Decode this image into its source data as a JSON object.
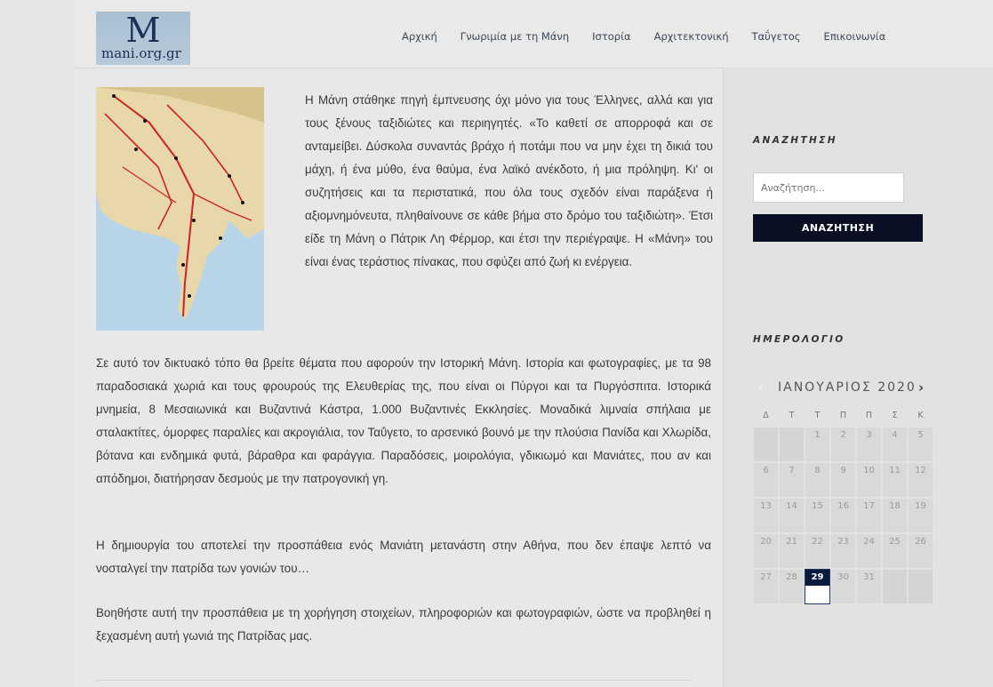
{
  "site": {
    "logo_letter": "M",
    "logo_text": "mani.org.gr"
  },
  "nav": [
    "Αρχική",
    "Γνωριμία με τη Μάνη",
    "Ιστορία",
    "Αρχιτεκτονική",
    "Ταΰγετος",
    "Επικοινωνία"
  ],
  "content": {
    "intro": "Η Μάνη στάθηκε πηγή έμπνευσης όχι μόνο για τους Έλληνες, αλλά και για τους ξένους ταξιδιώτες και περιηγητές. «Το καθετί σε απορροφά και σε ανταμείβει. Δύσκολα συναντάς βράχο ή ποτάμι που να μην έχει τη δικιά του μάχη, ή ένα μύθο, ένα θαύμα, ένα λαϊκό ανέκδοτο, ή μια πρόληψη. Κι' οι συζητήσεις και τα περιστατικά, που όλα τους σχεδόν είναι παράξενα ή αξιομνημόνευτα, πληθαίνουνε σε κάθε βήμα στο δρόμο του ταξιδιώτη». Έτσι είδε τη Μάνη ο Πάτρικ Λη Φέρμορ, και έτσι την περιέγραψε. Η «Μάνη» του είναι ένας τεράστιος πίνακας, που σφύζει από ζωή κι ενέργεια.",
    "p1": "Σε αυτό τον δικτυακό τόπο θα βρείτε θέματα που αφορούν την Ιστορική Μάνη. Ιστορία και φωτογραφίες, με τα 98 παραδοσιακά χωριά και τους φρουρούς της Ελευθερίας της, που είναι οι Πύργοι και τα Πυργόσπιτα. Ιστορικά μνημεία, 8 Μεσαιωνικά και Βυζαντινά Κάστρα, 1.000 Βυζαντινές Εκκλησίες. Μοναδικά λιμναία σπήλαια με σταλακτίτες, όμορφες παραλίες και ακρογιάλια, τον Ταΰγετο, το αρσενικό βουνό με την πλούσια Πανίδα και Χλωρίδα, βότανα και ενδημικά φυτά, βάραθρα και φαράγγια. Παραδόσεις, μοιρολόγια, γδικιωμό και Μανιάτες, που αν και απόδημοι, διατήρησαν δεσμούς με την πατρογονική γη.",
    "p2": "Η δημιουργία του αποτελεί την προσπάθεια ενός Μανιάτη μετανάστη στην Αθήνα, που δεν έπαψε λεπτό να νοσταλγεί την πατρίδα των γονιών του…",
    "p3": "Βοηθήστε αυτή την προσπάθεια με τη χορήγηση στοιχείων, πληροφοριών και φωτογραφιών, ώστε να προβληθεί η ξεχασμένη αυτή γωνιά της Πατρίδας μας."
  },
  "sidebar": {
    "search_title": "ΑΝΑΖΗΤΗΣΗ",
    "search_placeholder": "Αναζήτηση...",
    "search_button": "ΑΝΑΖΗΤΗΣΗ",
    "calendar_title": "ΗΜΕΡΟΛΟΓΙΟ"
  },
  "calendar": {
    "month": "ΙΑΝΟΥΑΡΙΟΣ 2020",
    "prev": "‹",
    "next": "›",
    "weekdays": [
      "Δ",
      "Τ",
      "Τ",
      "Π",
      "Π",
      "Σ",
      "Κ"
    ],
    "leading_blanks": 2,
    "days": 31,
    "today": 29
  }
}
